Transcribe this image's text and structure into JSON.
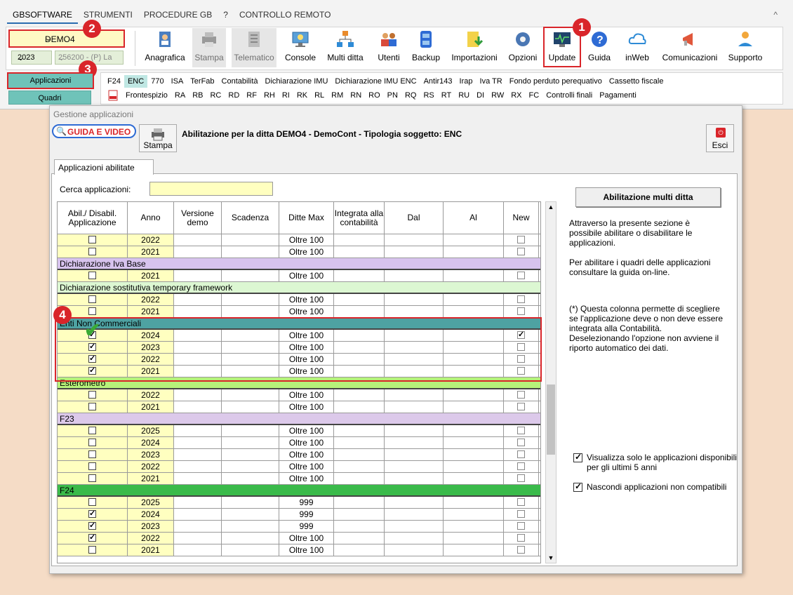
{
  "menu": {
    "items": [
      "GBSOFTWARE",
      "STRUMENTI",
      "PROCEDURE GB",
      "?",
      "CONTROLLO REMOTO"
    ],
    "collapse_glyph": "^"
  },
  "company": {
    "value": "DEMO4",
    "year": "2023",
    "code": "256200 - (P) La"
  },
  "toolbar": {
    "anagrafica": "Anagrafica",
    "stampa": "Stampa",
    "telematico": "Telematico",
    "console": "Console",
    "multiditta": "Multi ditta",
    "utenti": "Utenti",
    "backup": "Backup",
    "importazioni": "Importazioni",
    "opzioni": "Opzioni",
    "update": "Update",
    "guida": "Guida",
    "inweb": "inWeb",
    "comunicazioni": "Comunicazioni",
    "supporto": "Supporto"
  },
  "badges": {
    "b1": "1",
    "b2": "2",
    "b3": "3",
    "b4": "4"
  },
  "side": {
    "applicazioni": "Applicazioni",
    "quadri": "Quadri"
  },
  "nav_row1": [
    "F24",
    "ENC",
    "770",
    "ISA",
    "TerFab",
    "Contabilità",
    "Dichiarazione IMU",
    "Dichiarazione IMU ENC",
    "Antir143",
    "Irap",
    "Iva TR",
    "Fondo perduto perequativo",
    "Cassetto fiscale"
  ],
  "nav_row2": [
    "Frontespizio",
    "RA",
    "RB",
    "RC",
    "RD",
    "RF",
    "RH",
    "RI",
    "RK",
    "RL",
    "RM",
    "RN",
    "RO",
    "PN",
    "RQ",
    "RS",
    "RT",
    "RU",
    "DI",
    "RW",
    "RX",
    "FC",
    "Controlli finali",
    "Pagamenti"
  ],
  "dialog": {
    "title": "Gestione applicazioni",
    "guide": "GUIDA E VIDEO",
    "print": "Stampa",
    "header": "Abilitazione per la ditta DEMO4 -  DemoCont - Tipologia soggetto: ENC",
    "esci": "Esci",
    "tab": "Applicazioni abilitate",
    "search_label": "Cerca applicazioni:",
    "search_value": "",
    "multi_button": "Abilitazione multi ditta",
    "info1": "Attraverso la presente sezione è possibile abilitare o disabilitare le applicazioni.\n\nPer abilitare i quadri delle applicazioni consultare la guida on-line.",
    "info2": "(*) Questa colonna permette di scegliere se l'applicazione deve o non deve essere integrata alla Contabilità. Deselezionando l'opzione non avviene il riporto automatico dei dati.",
    "opt1": "Visualizza solo le applicazioni disponibili per gli ultimi 5 anni",
    "opt2": "Nascondi applicazioni non compatibili"
  },
  "grid": {
    "headers": [
      "Abil./ Disabil. Applicazione",
      "Anno",
      "Versione demo",
      "Scadenza",
      "Ditte Max",
      "Integrata alla contabilità",
      "Dal",
      "Al",
      "New"
    ],
    "sections": [
      {
        "name": "",
        "color": "",
        "rows": [
          {
            "abil": false,
            "anno": "2022",
            "ditte": "Oltre 100",
            "new": false
          },
          {
            "abil": false,
            "anno": "2021",
            "ditte": "Oltre 100",
            "new": false
          }
        ]
      },
      {
        "name": "Dichiarazione Iva Base",
        "color": "#d7c3ee",
        "rows": [
          {
            "abil": false,
            "anno": "2021",
            "ditte": "Oltre 100",
            "new": false
          }
        ]
      },
      {
        "name": "Dichiarazione sostitutiva temporary framework",
        "color": "#dcf7d2",
        "rows": [
          {
            "abil": false,
            "anno": "2022",
            "ditte": "Oltre 100",
            "new": false
          },
          {
            "abil": false,
            "anno": "2021",
            "ditte": "Oltre 100",
            "new": false
          }
        ]
      },
      {
        "name": "Enti Non Commerciali",
        "color": "#4ea2a2",
        "rows": [
          {
            "abil": true,
            "anno": "2024",
            "ditte": "Oltre 100",
            "new": true
          },
          {
            "abil": true,
            "anno": "2023",
            "ditte": "Oltre 100",
            "new": false
          },
          {
            "abil": true,
            "anno": "2022",
            "ditte": "Oltre 100",
            "new": false
          },
          {
            "abil": true,
            "anno": "2021",
            "ditte": "Oltre 100",
            "new": false
          }
        ]
      },
      {
        "name": "Esterometro",
        "color": "#b6f27a",
        "rows": [
          {
            "abil": false,
            "anno": "2022",
            "ditte": "Oltre 100",
            "new": false
          },
          {
            "abil": false,
            "anno": "2021",
            "ditte": "Oltre 100",
            "new": false
          }
        ]
      },
      {
        "name": "F23",
        "color": "#dcc9ea",
        "rows": [
          {
            "abil": false,
            "anno": "2025",
            "ditte": "Oltre 100",
            "new": false
          },
          {
            "abil": false,
            "anno": "2024",
            "ditte": "Oltre 100",
            "new": false
          },
          {
            "abil": false,
            "anno": "2023",
            "ditte": "Oltre 100",
            "new": false
          },
          {
            "abil": false,
            "anno": "2022",
            "ditte": "Oltre 100",
            "new": false
          },
          {
            "abil": false,
            "anno": "2021",
            "ditte": "Oltre 100",
            "new": false
          }
        ]
      },
      {
        "name": "F24",
        "color": "#3aba4a",
        "rows": [
          {
            "abil": false,
            "anno": "2025",
            "ditte": "999",
            "new": false
          },
          {
            "abil": true,
            "anno": "2024",
            "ditte": "999",
            "new": false
          },
          {
            "abil": true,
            "anno": "2023",
            "ditte": "999",
            "new": false
          },
          {
            "abil": true,
            "anno": "2022",
            "ditte": "Oltre 100",
            "new": false
          },
          {
            "abil": false,
            "anno": "2021",
            "ditte": "Oltre 100",
            "new": false
          }
        ]
      }
    ]
  },
  "colors": {
    "highlight": "#d9252a",
    "teal": "#6fc3b9",
    "yellow_cell": "#ffffc0"
  }
}
